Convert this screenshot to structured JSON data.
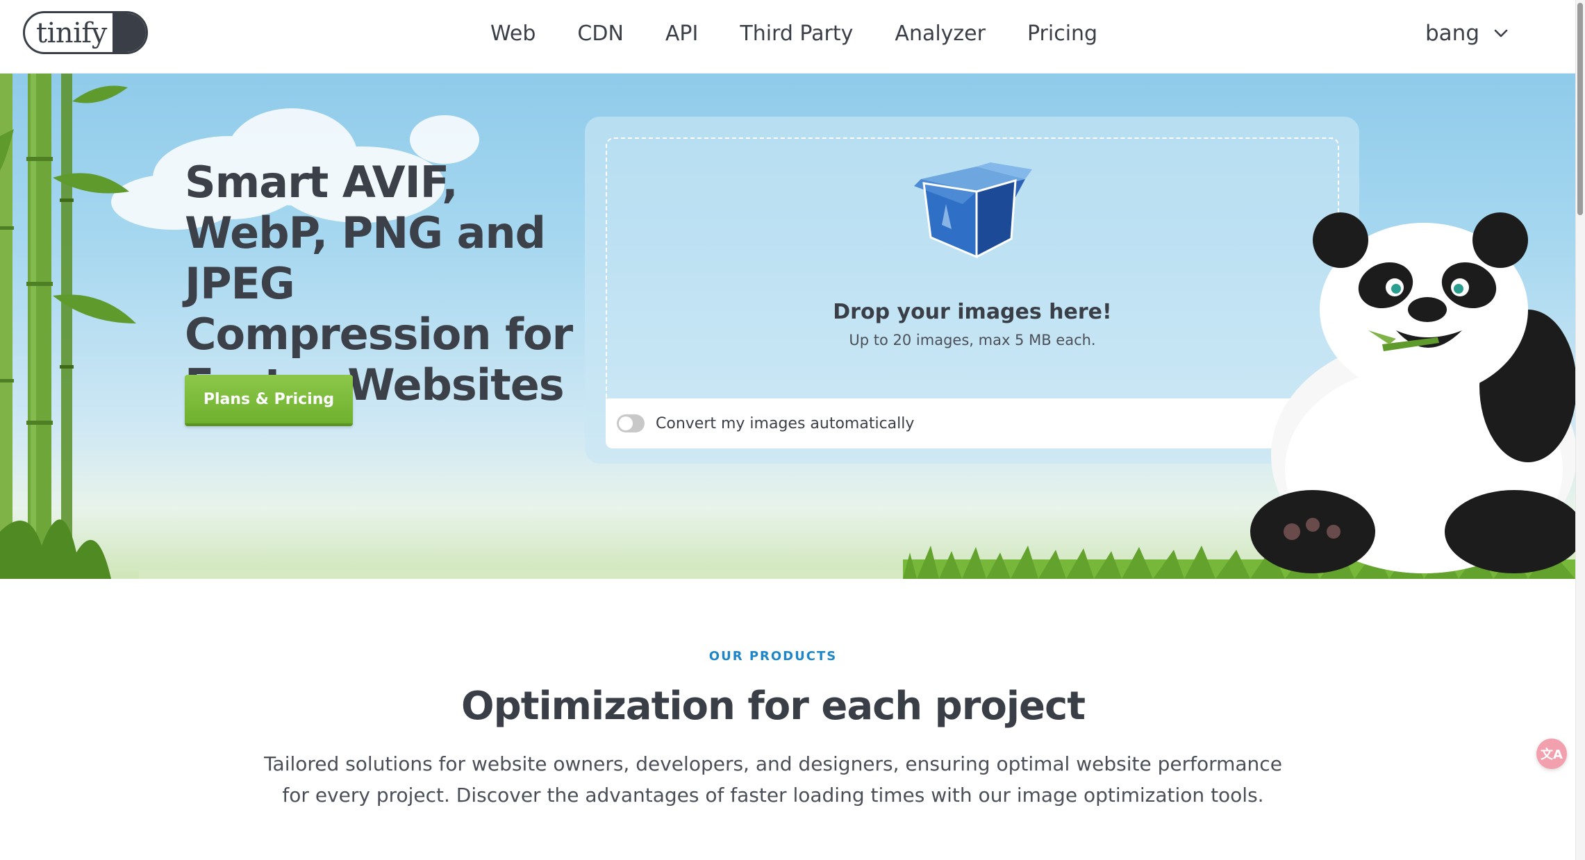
{
  "header": {
    "logo_text": "tinify",
    "nav": [
      "Web",
      "CDN",
      "API",
      "Third Party",
      "Analyzer",
      "Pricing"
    ],
    "user_name": "bang",
    "user_menu_icon": "chevron-down-icon"
  },
  "hero": {
    "title": "Smart AVIF, WebP, PNG and JPEG Compression for Faster Websites",
    "cta_label": "Plans & Pricing",
    "dropzone": {
      "icon": "open-box-icon",
      "title": "Drop your images here!",
      "subtitle": "Up to 20 images, max 5 MB each.",
      "convert_label": "Convert my images automatically",
      "convert_enabled": false
    }
  },
  "products": {
    "eyebrow": "OUR PRODUCTS",
    "title": "Optimization for each project",
    "description": "Tailored solutions for website owners, developers, and designers, ensuring optimal website performance for every project. Discover the advantages of faster loading times with our image optimization tools."
  },
  "floating": {
    "translate_label": "文A",
    "translate_icon": "translate-icon"
  },
  "colors": {
    "text_dark": "#3a3f47",
    "cta_green": "#76b835",
    "eyebrow_blue": "#1e86c8",
    "sky": "#a8d8f0"
  }
}
